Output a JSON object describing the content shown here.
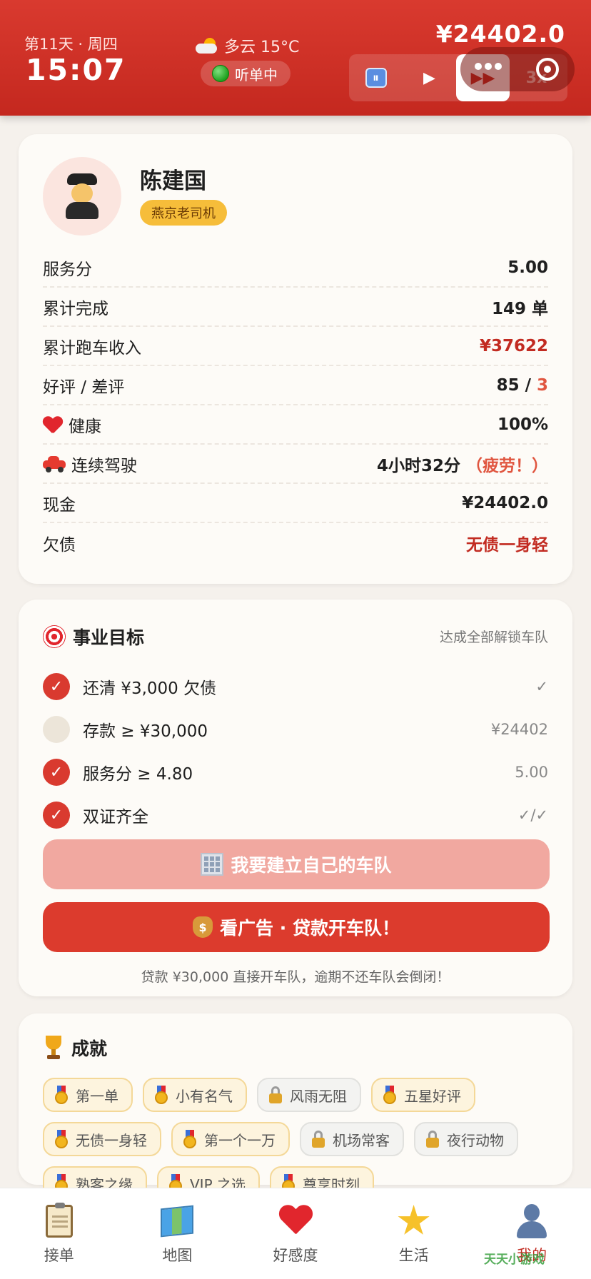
{
  "header": {
    "day": "第11天 · 周四",
    "time": "15:07",
    "weather": "多云 15°C",
    "status": "听单中",
    "cash": "¥24402.0",
    "speed_controls": [
      "⏸",
      "▶",
      "▶▶",
      "3x"
    ]
  },
  "profile": {
    "name": "陈建国",
    "badge": "燕京老司机",
    "stats": [
      {
        "label": "服务分",
        "value": "5.00"
      },
      {
        "label": "累计完成",
        "value": "149 单"
      },
      {
        "label": "累计跑车收入",
        "value": "¥37622"
      },
      {
        "label": "好评 / 差评",
        "value_good": "85 / ",
        "value_bad": "3"
      },
      {
        "label": "健康",
        "value": "100%"
      },
      {
        "label": "连续驾驶",
        "value": "4小时32分",
        "warning": "（疲劳！）"
      },
      {
        "label": "现金",
        "value": "¥24402.0"
      },
      {
        "label": "欠债",
        "value": "无债一身轻"
      }
    ]
  },
  "goals": {
    "title": "事业目标",
    "subtitle": "达成全部解锁车队",
    "items": [
      {
        "label": "还清 ¥3,000 欠债",
        "status": "✓",
        "done": true
      },
      {
        "label": "存款 ≥ ¥30,000",
        "status": "¥24402",
        "done": false
      },
      {
        "label": "服务分 ≥ 4.80",
        "status": "5.00",
        "done": true
      },
      {
        "label": "双证齐全",
        "status": "✓/✓",
        "done": true
      }
    ],
    "build_fleet_button": "我要建立自己的车队",
    "loan_button": "看广告 · 贷款开车队！",
    "note": "贷款 ¥30,000 直接开车队，逾期不还车队会倒闭！"
  },
  "achievements": {
    "title": "成就",
    "items": [
      {
        "label": "第一单",
        "unlocked": true
      },
      {
        "label": "小有名气",
        "unlocked": true
      },
      {
        "label": "风雨无阻",
        "unlocked": false
      },
      {
        "label": "五星好评",
        "unlocked": true
      },
      {
        "label": "无债一身轻",
        "unlocked": true
      },
      {
        "label": "第一个一万",
        "unlocked": true
      },
      {
        "label": "机场常客",
        "unlocked": false
      },
      {
        "label": "夜行动物",
        "unlocked": false
      },
      {
        "label": "熟客之缘",
        "unlocked": true
      },
      {
        "label": "VIP 之选",
        "unlocked": true
      },
      {
        "label": "尊享时刻",
        "unlocked": true
      }
    ]
  },
  "tabs": [
    {
      "label": "接单",
      "icon": "clipboard-icon"
    },
    {
      "label": "地图",
      "icon": "map-icon"
    },
    {
      "label": "好感度",
      "icon": "heart-icon"
    },
    {
      "label": "生活",
      "icon": "star-icon"
    },
    {
      "label": "我的",
      "icon": "person-icon"
    }
  ],
  "watermark": "天天小游戏",
  "colors": {
    "primary": "#d93a2f",
    "gold": "#f6bd3a",
    "bg": "#f5f1ec"
  }
}
